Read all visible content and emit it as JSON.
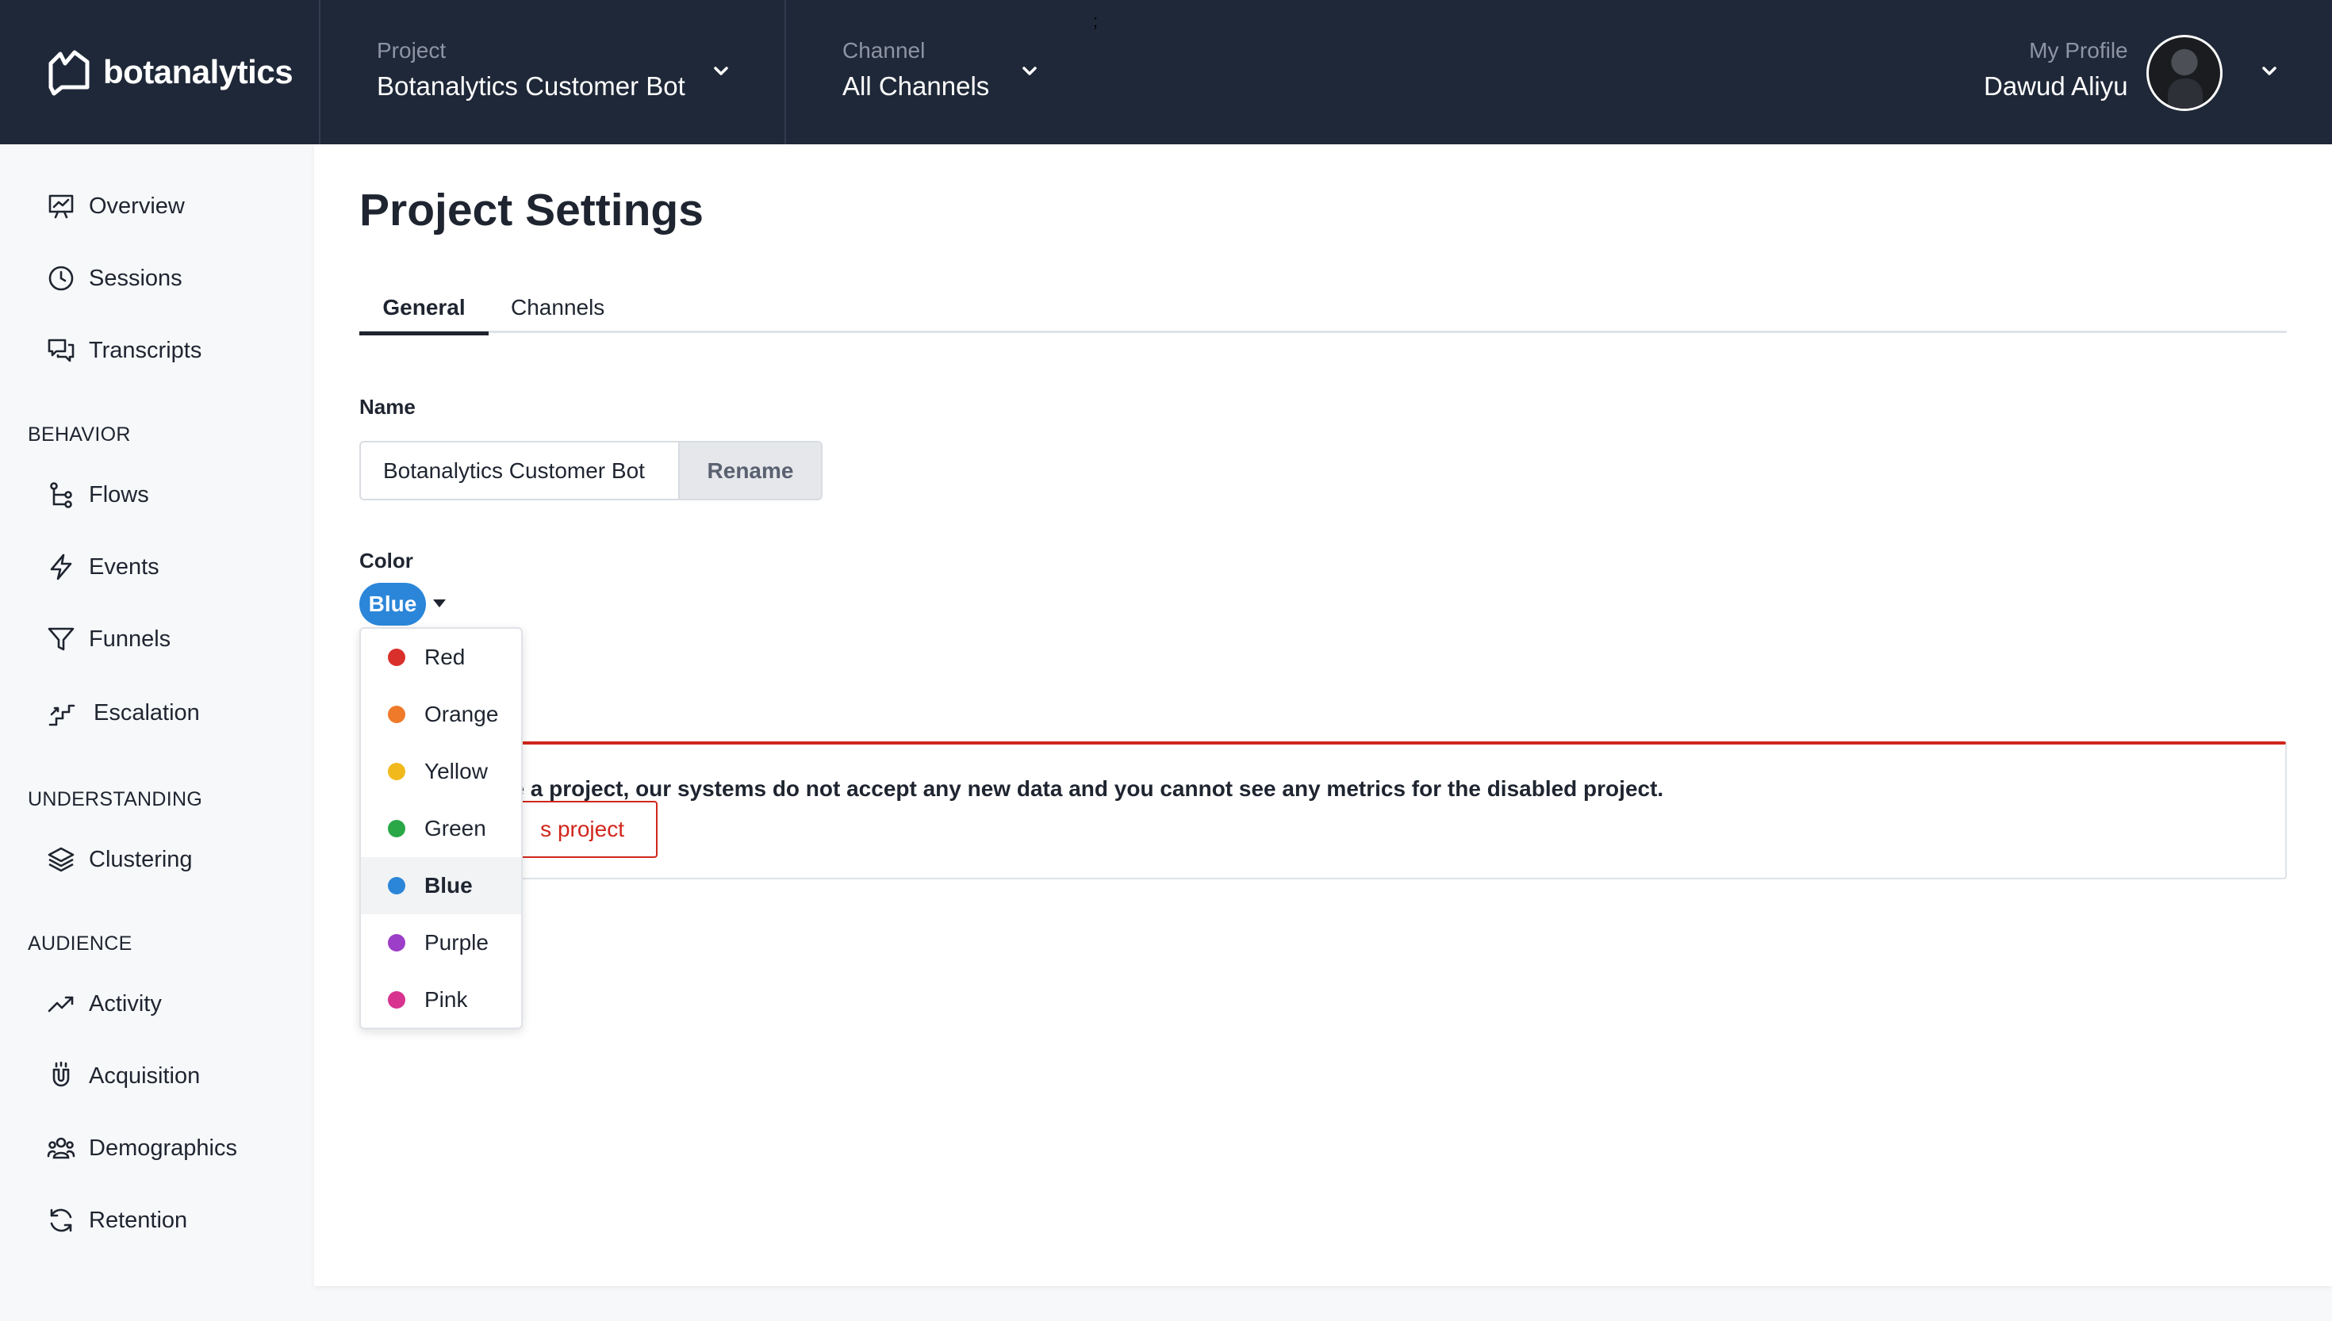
{
  "app": {
    "name": "botanalytics"
  },
  "header": {
    "project": {
      "label": "Project",
      "value": "Botanalytics Customer Bot"
    },
    "channel": {
      "label": "Channel",
      "value": "All Channels"
    },
    "profile": {
      "label": "My Profile",
      "value": "Dawud Aliyu"
    },
    "stray_mark": ";"
  },
  "sidebar": {
    "items_top": [
      {
        "label": "Overview",
        "icon": "presentation-chart-icon"
      },
      {
        "label": "Sessions",
        "icon": "clock-icon"
      },
      {
        "label": "Transcripts",
        "icon": "chat-bubbles-icon"
      }
    ],
    "behavior": {
      "title": "BEHAVIOR",
      "items": [
        {
          "label": "Flows",
          "icon": "flow-icon"
        },
        {
          "label": "Events",
          "icon": "lightning-icon"
        },
        {
          "label": "Funnels",
          "icon": "funnel-icon"
        },
        {
          "label": "Escalation",
          "icon": "escalation-icon"
        }
      ]
    },
    "understanding": {
      "title": "UNDERSTANDING",
      "items": [
        {
          "label": "Clustering",
          "icon": "layers-icon"
        }
      ]
    },
    "audience": {
      "title": "AUDIENCE",
      "items": [
        {
          "label": "Activity",
          "icon": "trend-up-icon"
        },
        {
          "label": "Acquisition",
          "icon": "magnet-icon"
        },
        {
          "label": "Demographics",
          "icon": "users-icon"
        },
        {
          "label": "Retention",
          "icon": "refresh-icon"
        }
      ]
    }
  },
  "main": {
    "title": "Project Settings",
    "tabs": [
      {
        "label": "General",
        "active": true
      },
      {
        "label": "Channels",
        "active": false
      }
    ],
    "name_field": {
      "label": "Name",
      "value": "Botanalytics Customer Bot",
      "button": "Rename"
    },
    "color_field": {
      "label": "Color",
      "selected": "Blue",
      "selected_color": "#2b86d9"
    },
    "danger": {
      "message_visible": "able a project, our systems do not accept any new data and you cannot see any metrics for the disabled project.",
      "button_visible": "s project",
      "accent": "#d0261c"
    }
  },
  "color_options": [
    {
      "label": "Red",
      "color": "#d9302c"
    },
    {
      "label": "Orange",
      "color": "#ee7a2a"
    },
    {
      "label": "Yellow",
      "color": "#f2b91c"
    },
    {
      "label": "Green",
      "color": "#2aa848"
    },
    {
      "label": "Blue",
      "color": "#2b86d9",
      "selected": true
    },
    {
      "label": "Purple",
      "color": "#9c3ec8"
    },
    {
      "label": "Pink",
      "color": "#d8338f"
    }
  ]
}
